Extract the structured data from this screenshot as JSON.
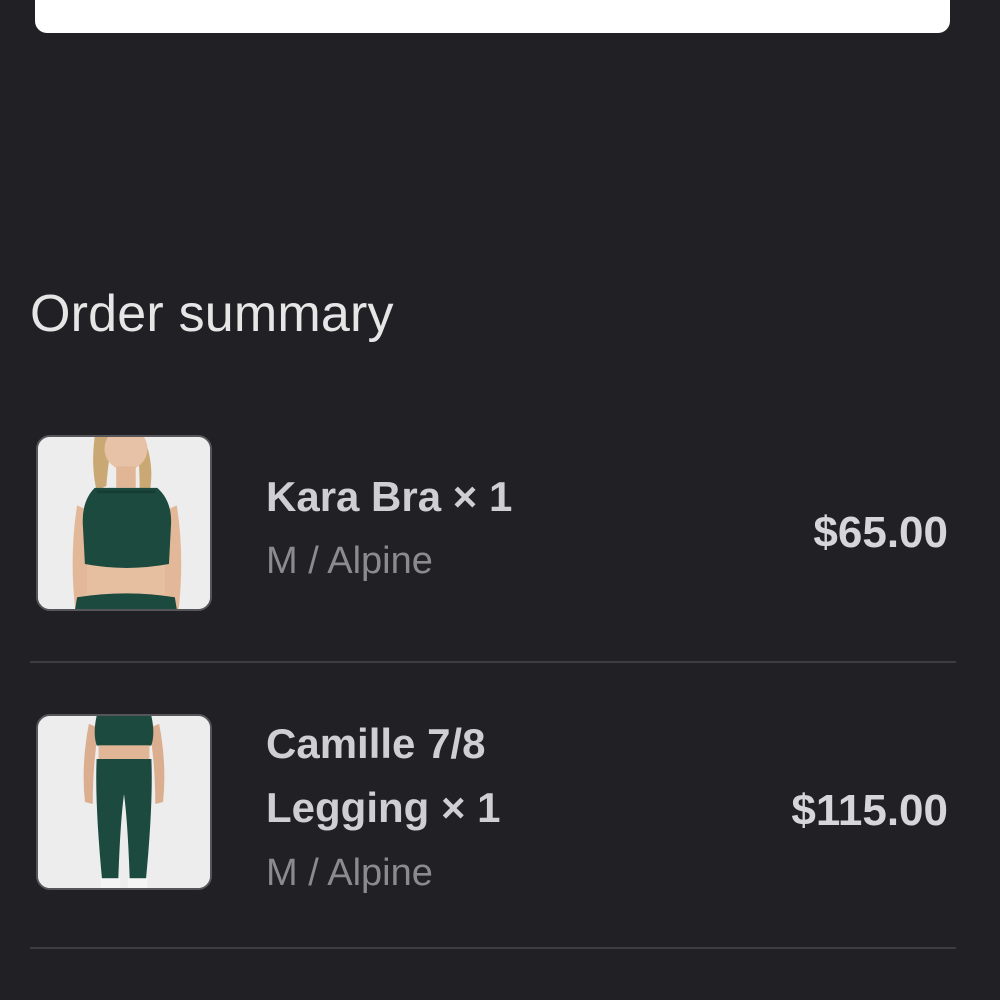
{
  "order_summary": {
    "title": "Order summary",
    "items": [
      {
        "name_line1": "Kara Bra × 1",
        "name_line2": "",
        "variant": "M / Alpine",
        "price": "$65.00",
        "thumbnail_icon": "product-photo-bra"
      },
      {
        "name_line1": "Camille 7/8",
        "name_line2": "Legging × 1",
        "variant": "M / Alpine",
        "price": "$115.00",
        "thumbnail_icon": "product-photo-legging"
      }
    ]
  },
  "colors": {
    "background": "#212125",
    "card": "#ffffff",
    "product_green": "#1d4a3f",
    "text_primary": "#cfcfd2",
    "text_secondary": "#8a8a8f"
  }
}
